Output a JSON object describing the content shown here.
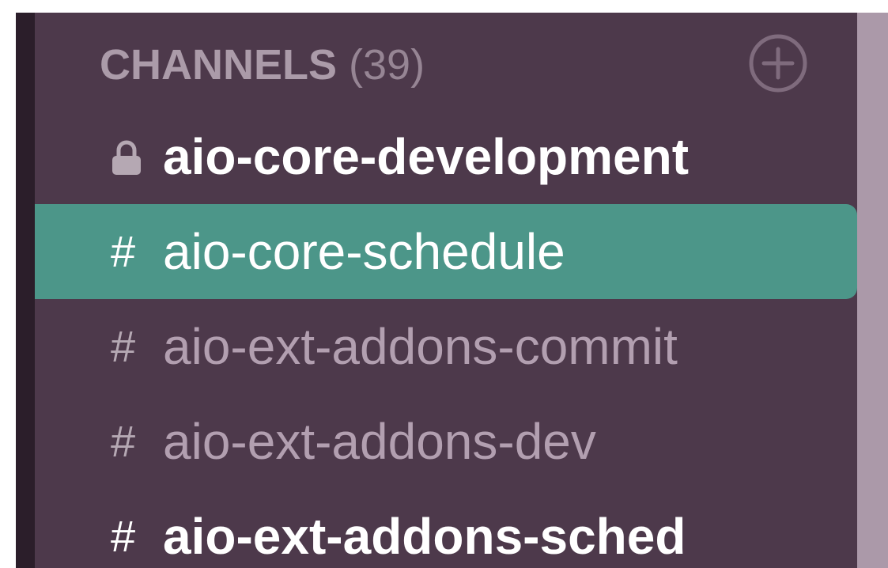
{
  "sidebar": {
    "section": {
      "title": "CHANNELS",
      "count": "(39)",
      "add_icon": "plus-circle-icon"
    },
    "channels": [
      {
        "prefix": "",
        "prefix_icon": "lock-icon",
        "name": "aio-core-development",
        "state": "unread"
      },
      {
        "prefix": "#",
        "prefix_icon": "hash-icon",
        "name": "aio-core-schedule",
        "state": "active"
      },
      {
        "prefix": "#",
        "prefix_icon": "hash-icon",
        "name": "aio-ext-addons-commit",
        "state": "read"
      },
      {
        "prefix": "#",
        "prefix_icon": "hash-icon",
        "name": "aio-ext-addons-dev",
        "state": "read"
      },
      {
        "prefix": "#",
        "prefix_icon": "hash-icon",
        "name": "aio-ext-addons-sched",
        "state": "unread"
      }
    ]
  },
  "colors": {
    "sidebar_bg": "#4d394b",
    "active_bg": "#4c9689",
    "scrollbar": "#ab99a9",
    "muted_text": "#b29fb0",
    "header_text": "#ab9ba9",
    "unread_text": "#ffffff"
  }
}
